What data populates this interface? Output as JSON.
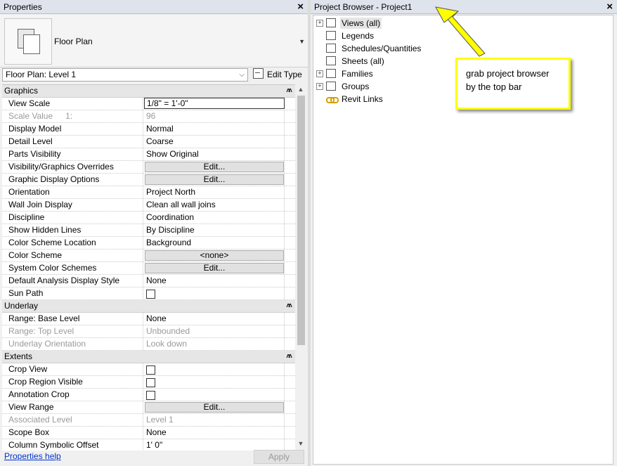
{
  "properties": {
    "title": "Properties",
    "close_glyph": "×",
    "type_name": "Floor Plan",
    "instance_selector": "Floor Plan: Level 1",
    "edit_type_label": "Edit Type",
    "help_link": "Properties help",
    "apply_label": "Apply",
    "sections": [
      {
        "name": "Graphics",
        "rows": [
          {
            "label": "View Scale",
            "value": "1/8\" = 1'-0\"",
            "kind": "boxed"
          },
          {
            "label": "Scale Value",
            "extra": "1:",
            "value": "96",
            "kind": "text",
            "disabled": true
          },
          {
            "label": "Display Model",
            "value": "Normal",
            "kind": "text"
          },
          {
            "label": "Detail Level",
            "value": "Coarse",
            "kind": "text"
          },
          {
            "label": "Parts Visibility",
            "value": "Show Original",
            "kind": "text"
          },
          {
            "label": "Visibility/Graphics Overrides",
            "value": "Edit...",
            "kind": "button"
          },
          {
            "label": "Graphic Display Options",
            "value": "Edit...",
            "kind": "button"
          },
          {
            "label": "Orientation",
            "value": "Project North",
            "kind": "text"
          },
          {
            "label": "Wall Join Display",
            "value": "Clean all wall joins",
            "kind": "text"
          },
          {
            "label": "Discipline",
            "value": "Coordination",
            "kind": "text"
          },
          {
            "label": "Show Hidden Lines",
            "value": "By Discipline",
            "kind": "text"
          },
          {
            "label": "Color Scheme Location",
            "value": "Background",
            "kind": "text"
          },
          {
            "label": "Color Scheme",
            "value": "<none>",
            "kind": "button"
          },
          {
            "label": "System Color Schemes",
            "value": "Edit...",
            "kind": "button"
          },
          {
            "label": "Default Analysis Display Style",
            "value": "None",
            "kind": "text"
          },
          {
            "label": "Sun Path",
            "value": "",
            "kind": "checkbox"
          }
        ]
      },
      {
        "name": "Underlay",
        "rows": [
          {
            "label": "Range: Base Level",
            "value": "None",
            "kind": "text"
          },
          {
            "label": "Range: Top Level",
            "value": "Unbounded",
            "kind": "text",
            "disabled": true
          },
          {
            "label": "Underlay Orientation",
            "value": "Look down",
            "kind": "text",
            "disabled": true
          }
        ]
      },
      {
        "name": "Extents",
        "rows": [
          {
            "label": "Crop View",
            "value": "",
            "kind": "checkbox"
          },
          {
            "label": "Crop Region Visible",
            "value": "",
            "kind": "checkbox"
          },
          {
            "label": "Annotation Crop",
            "value": "",
            "kind": "checkbox"
          },
          {
            "label": "View Range",
            "value": "Edit...",
            "kind": "button"
          },
          {
            "label": "Associated Level",
            "value": "Level 1",
            "kind": "text",
            "disabled": true
          },
          {
            "label": "Scope Box",
            "value": "None",
            "kind": "text"
          },
          {
            "label": "Column Symbolic Offset",
            "value": "1'  0\"",
            "kind": "text"
          }
        ]
      }
    ]
  },
  "browser": {
    "title": "Project Browser - Project1",
    "close_glyph": "×",
    "nodes": [
      {
        "label": "Views (all)",
        "expandable": true,
        "selected": true,
        "icon": "views-icon"
      },
      {
        "label": "Legends",
        "expandable": false,
        "icon": "legends-icon"
      },
      {
        "label": "Schedules/Quantities",
        "expandable": false,
        "icon": "schedules-icon"
      },
      {
        "label": "Sheets (all)",
        "expandable": false,
        "icon": "sheets-icon"
      },
      {
        "label": "Families",
        "expandable": true,
        "icon": "families-icon"
      },
      {
        "label": "Groups",
        "expandable": true,
        "icon": "groups-icon"
      },
      {
        "label": "Revit Links",
        "expandable": false,
        "icon": "links-icon"
      }
    ]
  },
  "annotation": {
    "text": "grab project browser by the top bar",
    "border_color": "#ffff00"
  }
}
